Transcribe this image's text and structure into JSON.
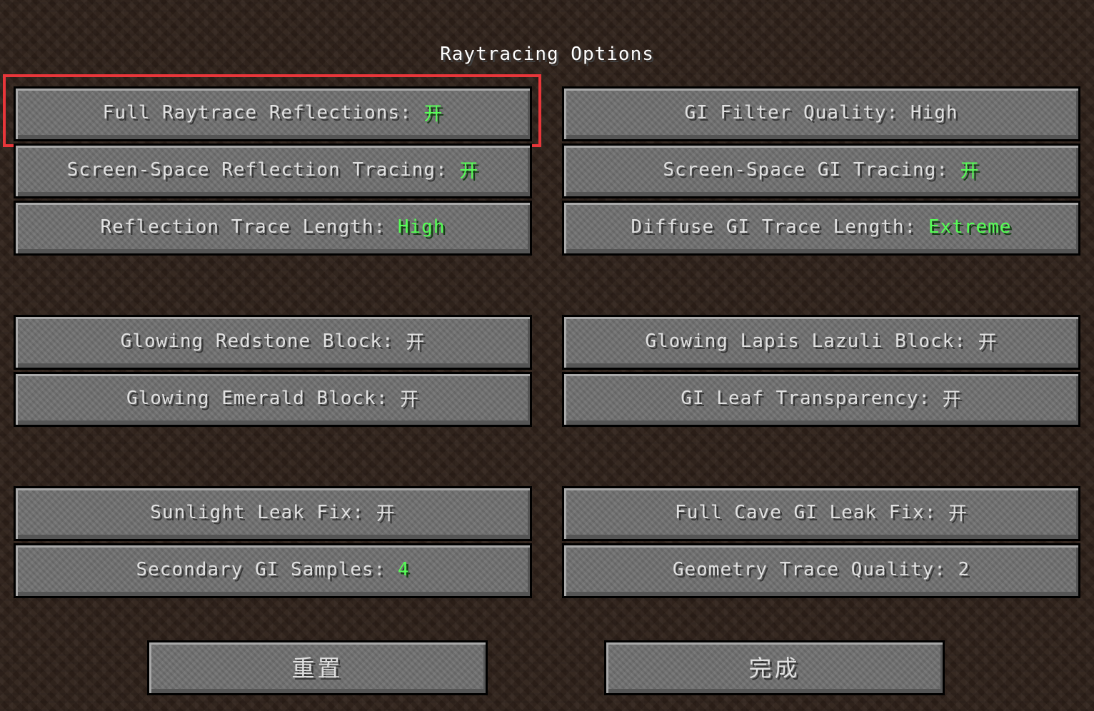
{
  "screen": {
    "title": "Raytracing Options"
  },
  "options": {
    "left": [
      {
        "label": "Full Raytrace Reflections: ",
        "value": "开",
        "value_state": "on"
      },
      {
        "label": "Screen-Space Reflection Tracing: ",
        "value": "开",
        "value_state": "on"
      },
      {
        "label": "Reflection Trace Length: ",
        "value": "High",
        "value_state": "on"
      },
      {
        "label": "Glowing Redstone Block: ",
        "value": "开",
        "value_state": "normal"
      },
      {
        "label": "Glowing Emerald Block: ",
        "value": "开",
        "value_state": "normal"
      },
      {
        "label": "Sunlight Leak Fix: ",
        "value": "开",
        "value_state": "normal"
      },
      {
        "label": "Secondary GI Samples: ",
        "value": "4",
        "value_state": "on"
      }
    ],
    "right": [
      {
        "label": "GI Filter Quality: ",
        "value": "High",
        "value_state": "normal"
      },
      {
        "label": "Screen-Space GI Tracing: ",
        "value": "开",
        "value_state": "on"
      },
      {
        "label": "Diffuse GI Trace Length: ",
        "value": "Extreme",
        "value_state": "on"
      },
      {
        "label": "Glowing Lapis Lazuli Block: ",
        "value": "开",
        "value_state": "normal"
      },
      {
        "label": "GI Leaf Transparency: ",
        "value": "开",
        "value_state": "normal"
      },
      {
        "label": "Full Cave GI Leak Fix: ",
        "value": "开",
        "value_state": "normal"
      },
      {
        "label": "Geometry Trace Quality: ",
        "value": "2",
        "value_state": "normal"
      }
    ]
  },
  "footer": {
    "reset_label": "重置",
    "done_label": "完成"
  },
  "colors": {
    "value_on": "#55ff55",
    "text": "#e0e0e0",
    "highlight_box": "#e8363a"
  }
}
